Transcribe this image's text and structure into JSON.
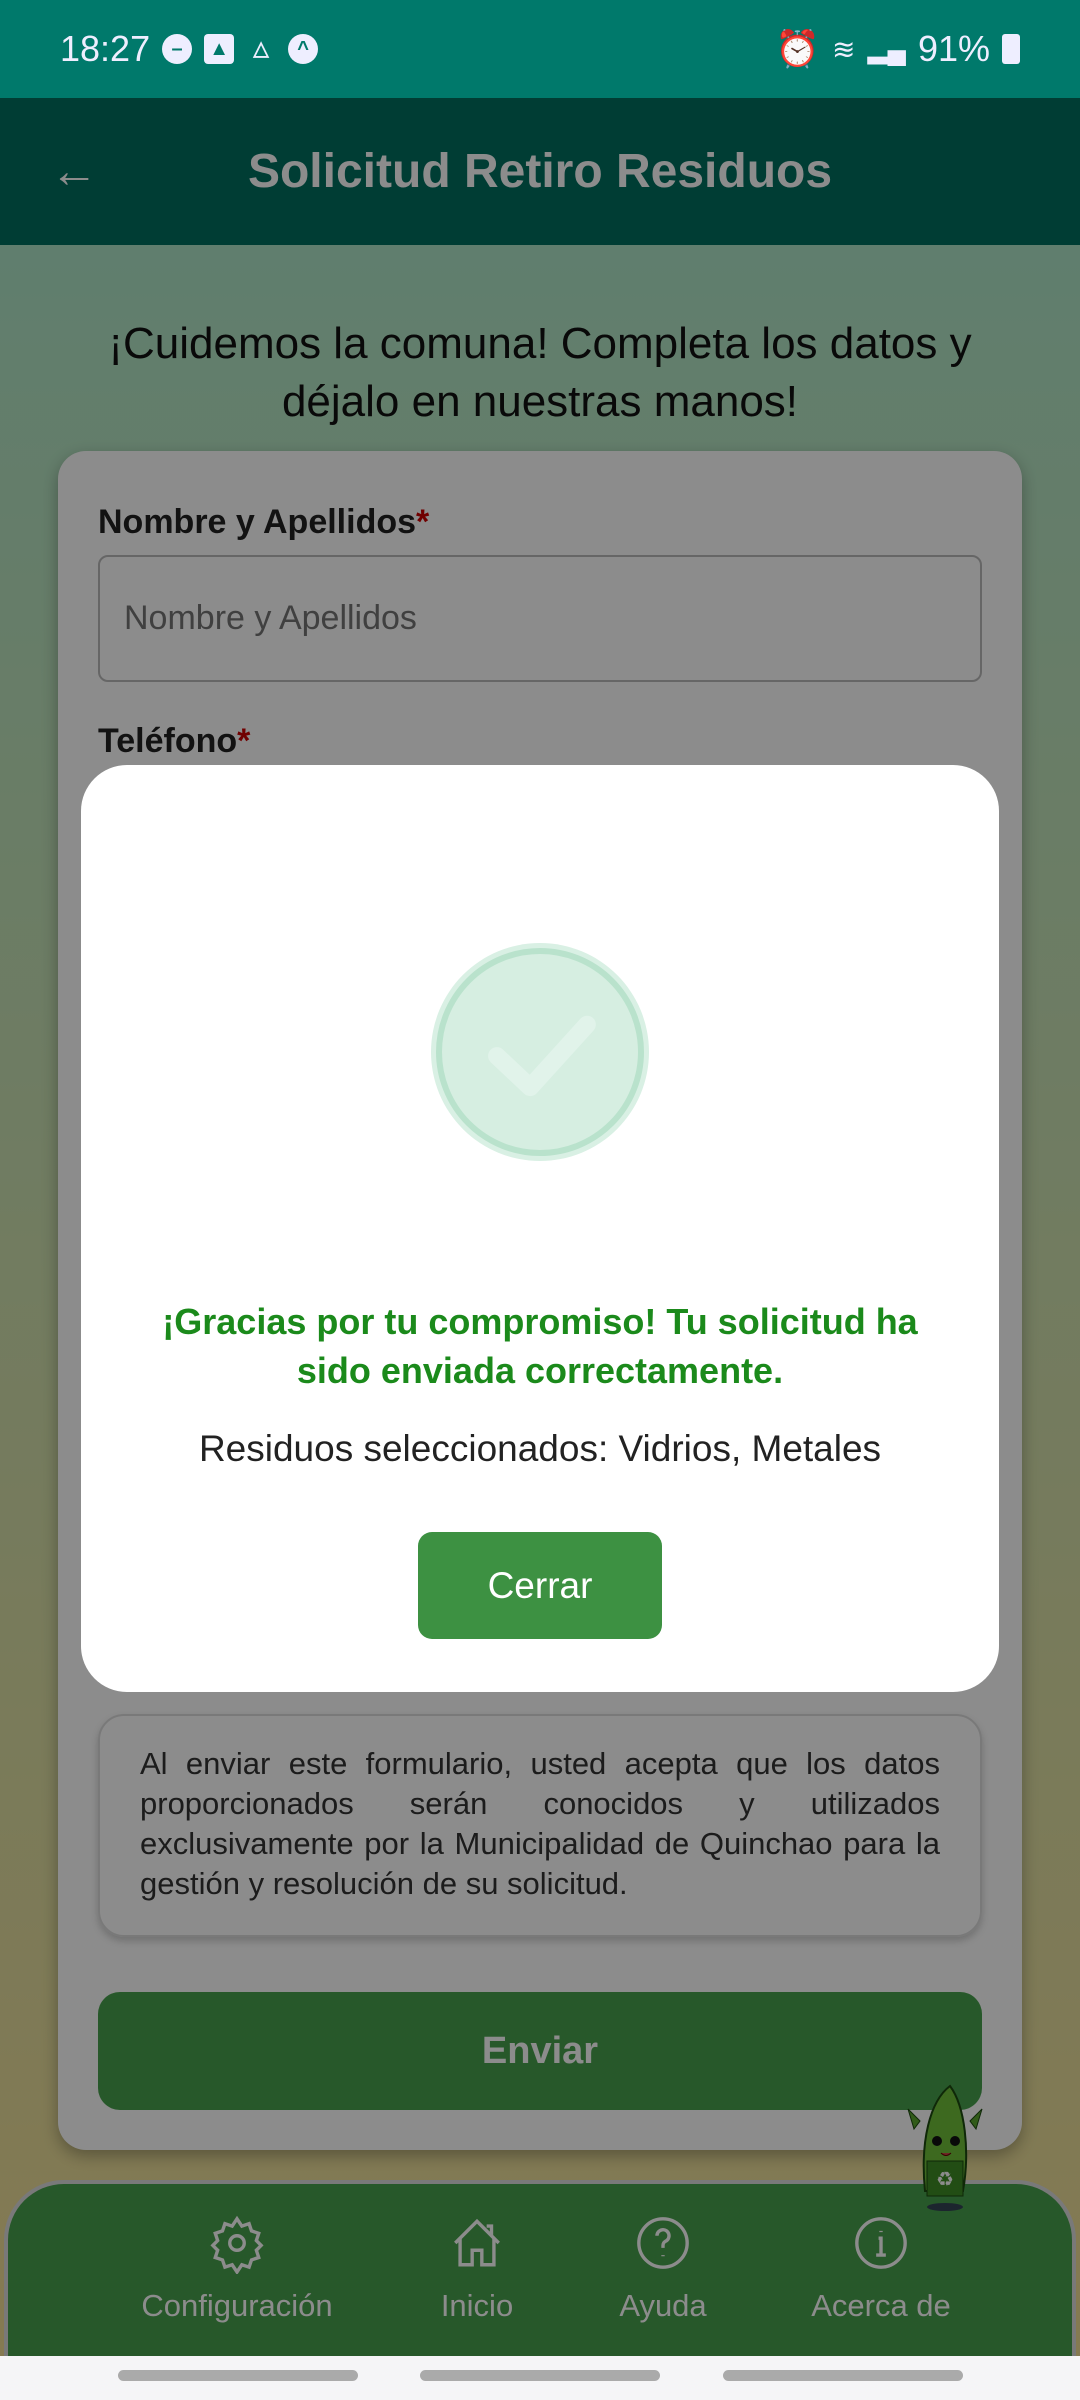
{
  "status": {
    "time": "18:27",
    "battery": "91%"
  },
  "appbar": {
    "title": "Solicitud Retiro Residuos"
  },
  "intro": "¡Cuidemos la comuna! Completa los datos y déjalo en nuestras manos!",
  "form": {
    "name_label": "Nombre y Apellidos",
    "name_placeholder": "Nombre y Apellidos",
    "phone_label": "Teléfono",
    "required": "*",
    "disclaimer": "Al enviar este formulario, usted acepta que los datos proporcionados serán conocidos y utilizados exclusivamente por la Municipalidad de Quinchao para la gestión y resolución de su solicitud.",
    "submit": "Enviar"
  },
  "modal": {
    "message": "¡Gracias por tu compromiso! Tu solicitud ha sido enviada correctamente.",
    "selected": "Residuos seleccionados: Vidrios, Metales",
    "close": "Cerrar"
  },
  "nav": [
    {
      "label": "Configuración",
      "icon": "gear-icon"
    },
    {
      "label": "Inicio",
      "icon": "home-icon"
    },
    {
      "label": "Ayuda",
      "icon": "help-icon"
    },
    {
      "label": "Acerca de",
      "icon": "info-icon"
    }
  ]
}
